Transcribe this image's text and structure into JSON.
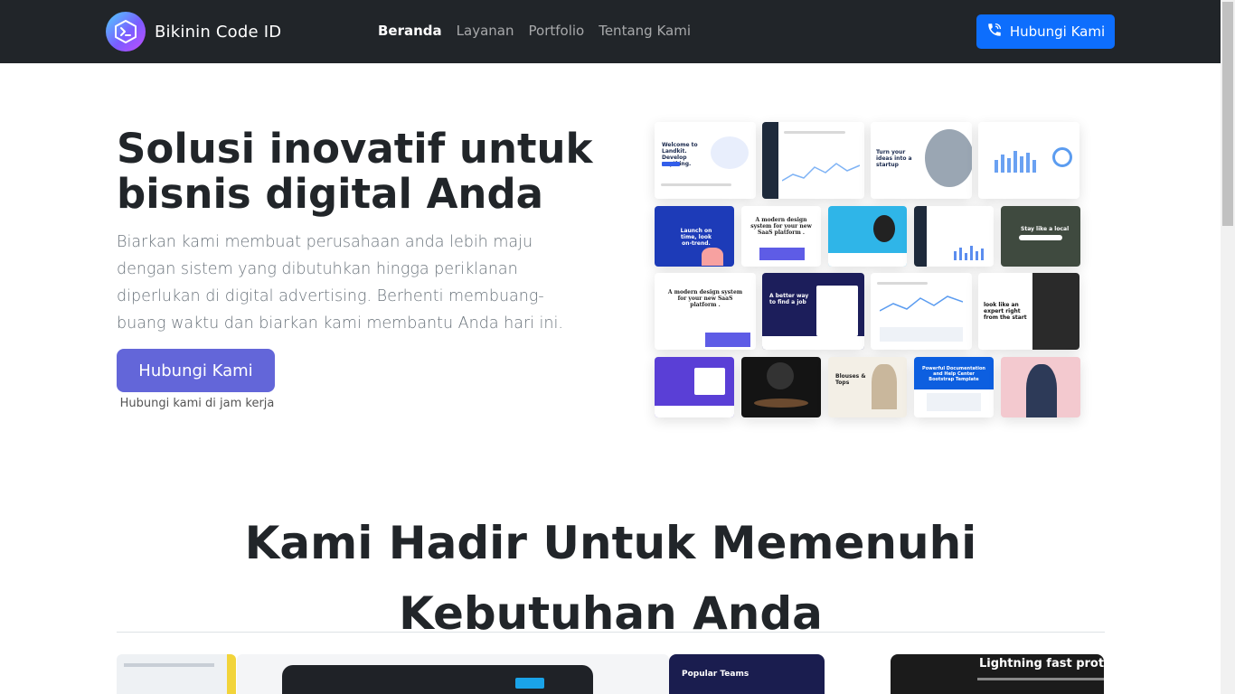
{
  "brand": {
    "name": "Bikinin Code ID",
    "logo_icon": "terminal-icon"
  },
  "nav": {
    "items": [
      {
        "label": "Beranda",
        "active": true
      },
      {
        "label": "Layanan",
        "active": false
      },
      {
        "label": "Portfolio",
        "active": false
      },
      {
        "label": "Tentang Kami",
        "active": false
      }
    ],
    "cta_label": "Hubungi Kami",
    "cta_icon": "phone-call-icon"
  },
  "hero": {
    "title": "Solusi inovatif untuk bisnis digital Anda",
    "description": "Biarkan kami membuat perusahaan anda lebih maju dengan sistem yang dibutuhkan hingga periklanan diperlukan di digital advertising. Berhenti membuang-buang waktu dan biarkan kami membantu Anda hari ini.",
    "button_label": "Hubungi Kami",
    "note": "Hubungi kami di jam kerja"
  },
  "mosaic": {
    "texts": {
      "t1": "Welcome to Landkit. Develop anything.",
      "t2": "Turn your ideas into a startup",
      "t3": "Launch on time, look on-trend.",
      "t4": "A modern design system for your new SaaS platform .",
      "t5": "Stay like a local",
      "t6": "A modern design system for your new SaaS platform .",
      "t7": "A better way to find a job",
      "t8": "look like an expert right from the start",
      "t9": "Blouses & Tops",
      "t10": "Powerful Documentation and Help Center Bootstrap Template"
    }
  },
  "section2": {
    "title": "Kami Hadir Untuk Memenuhi Kebutuhan Anda"
  },
  "strip": {
    "t1": "Popular Teams",
    "t2": "Lightning fast prototy"
  },
  "colors": {
    "navbar": "#212529",
    "primary": "#0d6efd",
    "hero_button": "#6366d9"
  }
}
